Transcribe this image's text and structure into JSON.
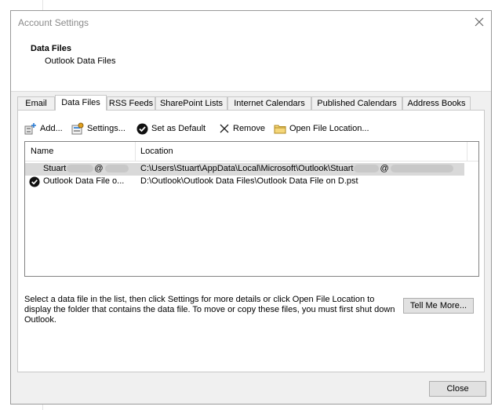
{
  "window": {
    "title": "Account Settings"
  },
  "header": {
    "title": "Data Files",
    "subtitle": "Outlook Data Files"
  },
  "tabs": [
    {
      "label": "Email"
    },
    {
      "label": "Data Files"
    },
    {
      "label": "RSS Feeds"
    },
    {
      "label": "SharePoint Lists"
    },
    {
      "label": "Internet Calendars"
    },
    {
      "label": "Published Calendars"
    },
    {
      "label": "Address Books"
    }
  ],
  "active_tab": "Data Files",
  "toolbar": {
    "add": "Add...",
    "settings": "Settings...",
    "set_default": "Set as Default",
    "remove": "Remove",
    "open_location": "Open File Location..."
  },
  "list": {
    "columns": [
      "Name",
      "Location"
    ],
    "rows": [
      {
        "name_prefix": "Stuart",
        "name_mid": "@",
        "location_prefix": "C:\\Users\\Stuart\\AppData\\Local\\Microsoft\\Outlook\\Stuart",
        "location_mid": "@",
        "selected": true,
        "default": false
      },
      {
        "name": "Outlook Data File o...",
        "location": "D:\\Outlook\\Outlook Data Files\\Outlook Data File on D.pst",
        "selected": false,
        "default": true
      }
    ]
  },
  "description": "Select a data file in the list, then click Settings for more details or click Open File Location to display the folder that contains the data file. To move or copy these files, you must first shut down Outlook.",
  "buttons": {
    "tell_more": "Tell Me More...",
    "close": "Close"
  }
}
